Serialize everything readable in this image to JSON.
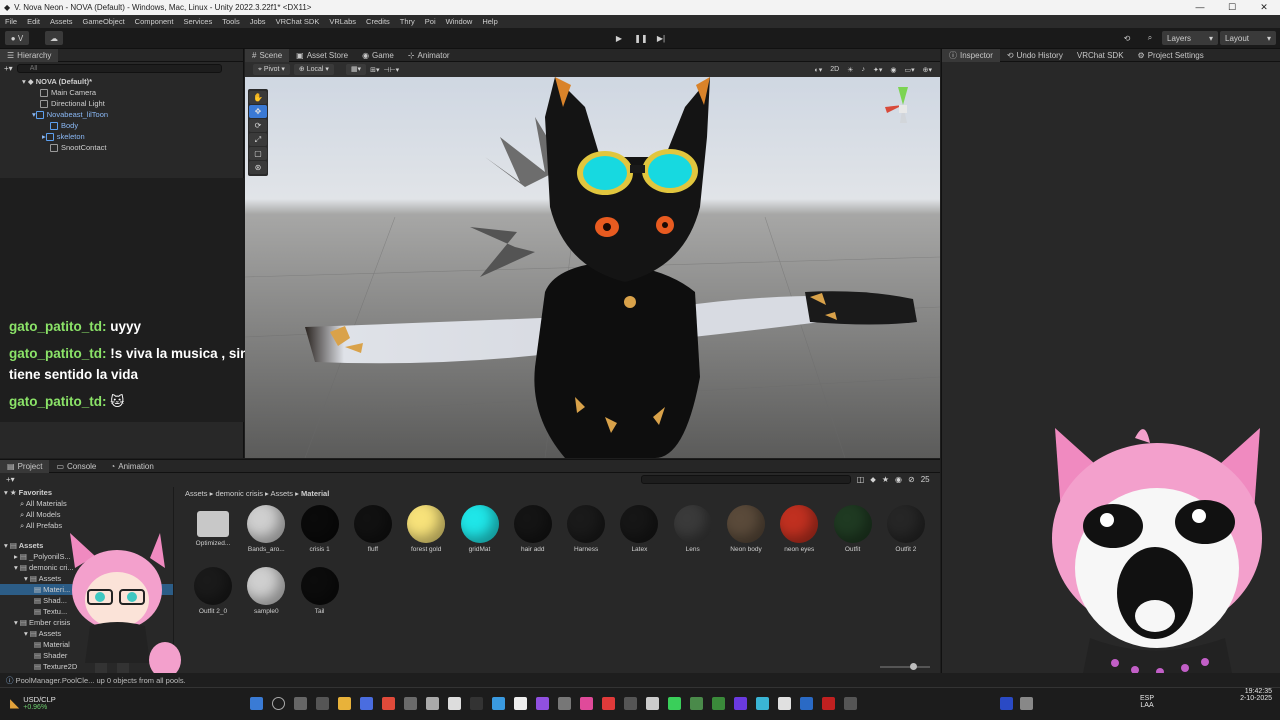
{
  "window": {
    "title": "V. Nova Neon - NOVA (Default) - Windows, Mac, Linux - Unity 2022.3.22f1* <DX11>",
    "controls": [
      "—",
      "☐",
      "✕"
    ]
  },
  "menu": [
    "File",
    "Edit",
    "Assets",
    "GameObject",
    "Component",
    "Services",
    "Tools",
    "Jobs",
    "VRChat SDK",
    "VRLabs",
    "Credits",
    "Thry",
    "Poi",
    "Window",
    "Help"
  ],
  "toolbar": {
    "account": "V",
    "layers_label": "Layers",
    "layout_label": "Layout"
  },
  "hierarchy": {
    "tab": "Hierarchy",
    "search_placeholder": "All",
    "items": [
      {
        "label": "NOVA (Default)*",
        "depth": 0
      },
      {
        "label": "Main Camera",
        "depth": 1
      },
      {
        "label": "Directional Light",
        "depth": 1
      },
      {
        "label": "Novabeast_lilToon",
        "depth": 1
      },
      {
        "label": "Body",
        "depth": 2
      },
      {
        "label": "skeleton",
        "depth": 2
      },
      {
        "label": "SnootContact",
        "depth": 2
      }
    ]
  },
  "chat": [
    {
      "user": "gato_patito_td:",
      "message": "uyyy"
    },
    {
      "user": "gato_patito_td:",
      "message": "!s viva la musica , sin ella no tiene sentido la vida"
    },
    {
      "user": "gato_patito_td:",
      "message": "🐱"
    }
  ],
  "scene": {
    "tabs": [
      "Scene",
      "Asset Store",
      "Game",
      "Animator"
    ],
    "pivot_label": "Pivot",
    "local_label": "Local",
    "mode_2d": "2D"
  },
  "inspector": {
    "tabs": [
      "Inspector",
      "Undo History",
      "VRChat SDK",
      "Project Settings"
    ]
  },
  "project": {
    "tabs": [
      "Project",
      "Console",
      "Animation"
    ],
    "count": "25",
    "breadcrumb": [
      "Assets",
      "demonic crisis",
      "Assets",
      "Material"
    ],
    "favorites": {
      "label": "Favorites",
      "items": [
        "All Materials",
        "All Models",
        "All Prefabs"
      ]
    },
    "tree": [
      {
        "label": "Assets",
        "depth": 0
      },
      {
        "label": "_PolyonilS...",
        "depth": 1
      },
      {
        "label": "demonic cri...",
        "depth": 1
      },
      {
        "label": "Assets",
        "depth": 2
      },
      {
        "label": "Materi...",
        "depth": 3
      },
      {
        "label": "Shad...",
        "depth": 3
      },
      {
        "label": "Textu...",
        "depth": 3
      },
      {
        "label": "Ember crisis",
        "depth": 1
      },
      {
        "label": "Assets",
        "depth": 2
      },
      {
        "label": "Material",
        "depth": 3
      },
      {
        "label": "Shader",
        "depth": 3
      },
      {
        "label": "Texture2D",
        "depth": 3
      }
    ],
    "assets": [
      {
        "label": "Optimized...",
        "color": "#c8c8c8",
        "kind": "folder"
      },
      {
        "label": "Bands_aro...",
        "color": "#cfcfcf"
      },
      {
        "label": "crisis 1",
        "color": "#0a0a0a"
      },
      {
        "label": "fluff",
        "color": "#111111"
      },
      {
        "label": "forest gold",
        "color": "#f7e27a"
      },
      {
        "label": "gridMat",
        "color": "#1fe6e8"
      },
      {
        "label": "hair add",
        "color": "#141414"
      },
      {
        "label": "Harness",
        "color": "#1a1a1a"
      },
      {
        "label": "Latex",
        "color": "#161616"
      },
      {
        "label": "Lens",
        "color": "#3a3a3a"
      },
      {
        "label": "Neon body",
        "color": "#5a4a3a"
      },
      {
        "label": "neon eyes",
        "color": "#c03020"
      },
      {
        "label": "Outfit",
        "color": "#1f3a22"
      },
      {
        "label": "Outfit 2",
        "color": "#262626"
      },
      {
        "label": "Outfit 2_0",
        "color": "#1a1a1a"
      },
      {
        "label": "sample0",
        "color": "#cfcfcf"
      },
      {
        "label": "Tail",
        "color": "#0c0c0c"
      }
    ]
  },
  "status": {
    "text": "PoolManager.PoolCle... up 0 objects from all pools."
  },
  "taskbar": {
    "stock_label": "USD/CLP",
    "stock_change": "+0.96%",
    "lang_top": "ESP",
    "lang_bottom": "LAA",
    "time": "19:42:35",
    "date": "2-10-2025"
  },
  "colors": {
    "accent": "#3a79d4",
    "chat_user": "#8be368"
  }
}
